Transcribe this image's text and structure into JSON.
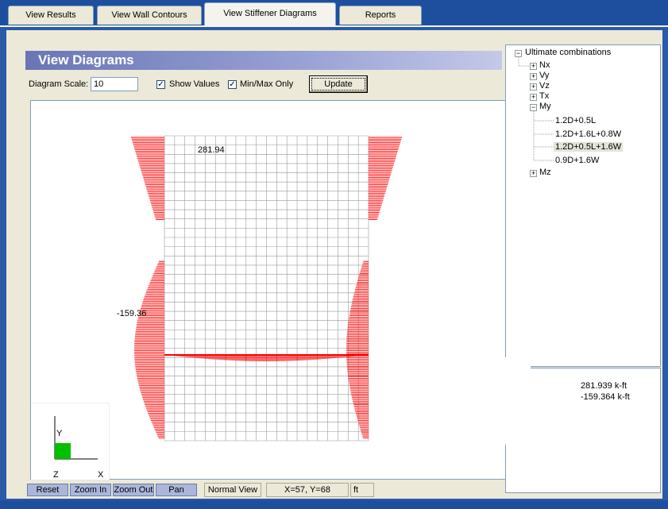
{
  "tabs": [
    {
      "label": "View Results"
    },
    {
      "label": "View Wall Contours"
    },
    {
      "label": "View Stiffener Diagrams"
    },
    {
      "label": "Reports"
    }
  ],
  "header": {
    "title": "View Diagrams"
  },
  "controls": {
    "scale_label": "Diagram Scale:",
    "scale_value": "10",
    "show_values_label": "Show Values",
    "show_values_checked": true,
    "minmax_label": "Min/Max Only",
    "minmax_checked": true,
    "update_label": "Update"
  },
  "diagram": {
    "max_label": "281.94",
    "min_label": "-159.36",
    "axis_y": "Y",
    "axis_z": "Z",
    "axis_x": "X",
    "diagram_color": "#ff0000"
  },
  "tree": {
    "root": "Ultimate combinations",
    "items": [
      "Nx",
      "Vy",
      "Vz",
      "Tx",
      "My",
      "Mz"
    ],
    "my_children": [
      "1.2D+0.5L",
      "1.2D+1.6L+0.8W",
      "1.2D+0.5L+1.6W",
      "0.9D+1.6W"
    ],
    "selected": "1.2D+0.5L+1.6W"
  },
  "results": {
    "max": "281.939 k-ft",
    "min": "-159.364 k-ft"
  },
  "toolbar": {
    "reset": "Reset",
    "zoom_in": "Zoom In",
    "zoom_out": "Zoom Out",
    "pan": "Pan",
    "view_mode": "Normal View",
    "coords": "X=57, Y=68",
    "unit": "ft"
  }
}
